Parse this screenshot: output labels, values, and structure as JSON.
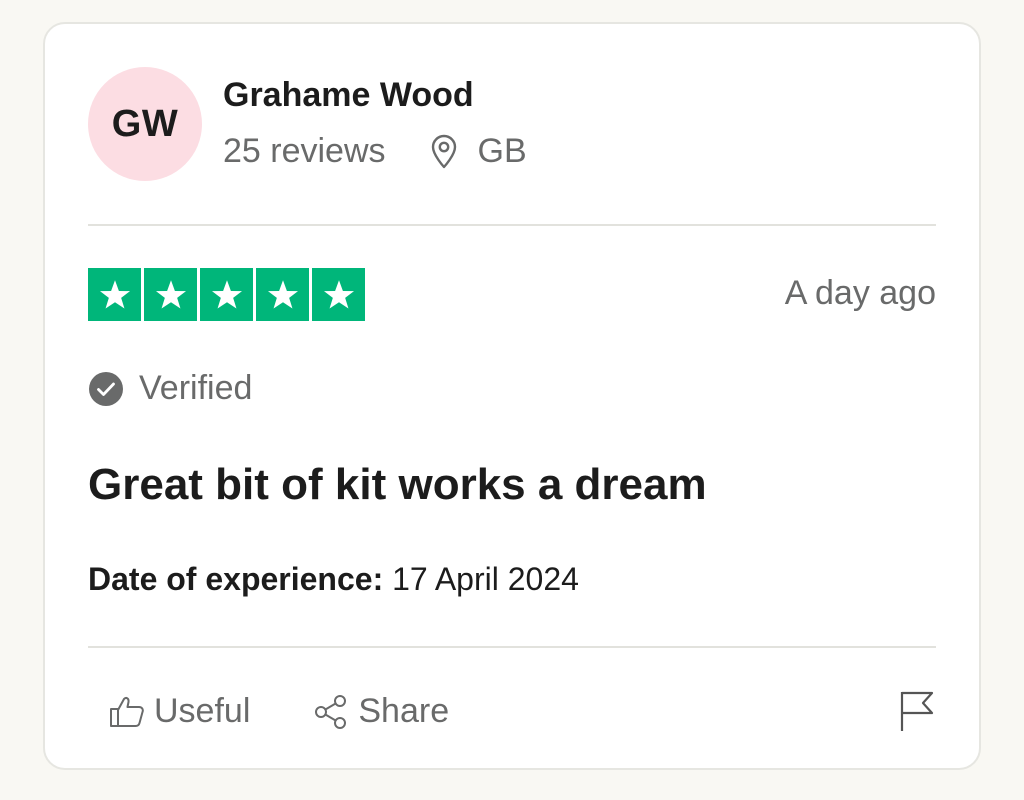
{
  "reviewer": {
    "initials": "GW",
    "name": "Grahame Wood",
    "reviews_count": "25 reviews",
    "country": "GB",
    "avatar_color": "#fcdde3"
  },
  "review": {
    "rating": 5,
    "rating_max": 5,
    "star_color": "#00b67a",
    "posted": "A day ago",
    "verified_label": "Verified",
    "title": "Great bit of kit works a dream",
    "experience_label": "Date of experience:",
    "experience_date": "17 April 2024"
  },
  "actions": {
    "useful_label": "Useful",
    "share_label": "Share"
  },
  "icons": {
    "location": "location-pin-icon",
    "verified": "check-circle-icon",
    "useful": "thumbs-up-icon",
    "share": "share-icon",
    "report": "flag-icon"
  }
}
